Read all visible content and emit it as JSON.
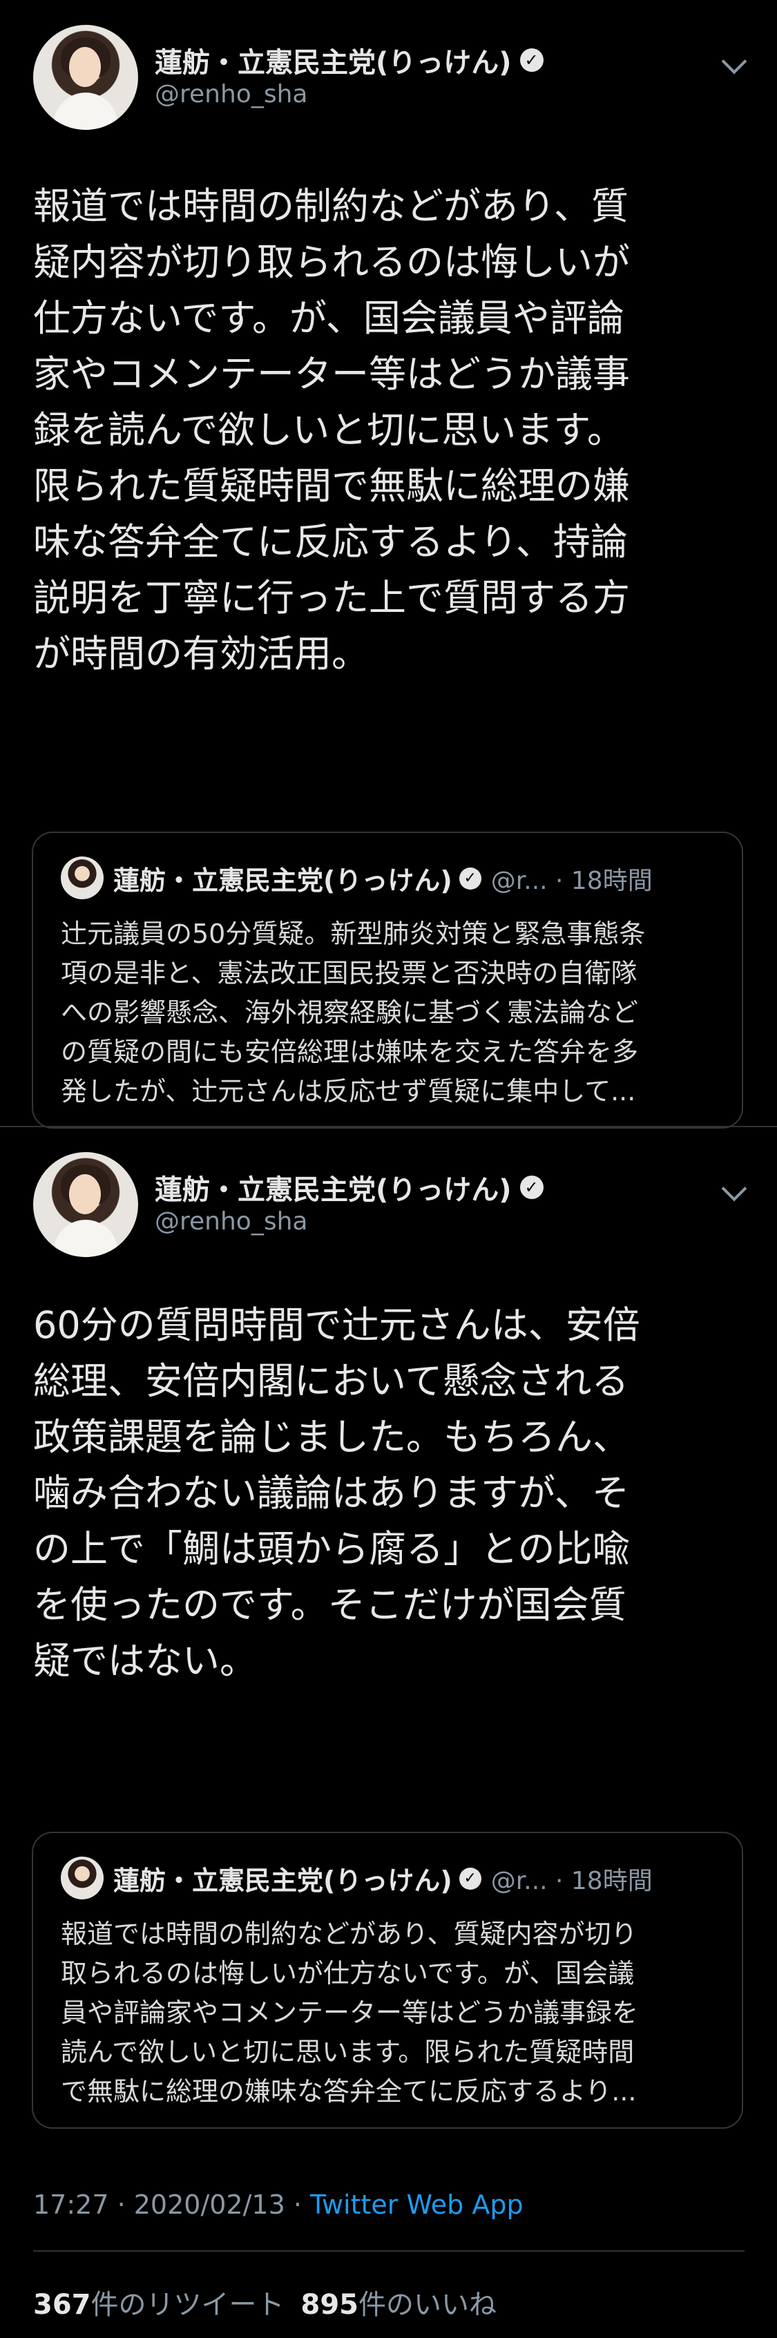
{
  "tweet1": {
    "author_name": "蓮舫・立憲民主党(りっけん)",
    "handle": "@renho_sha",
    "body": "報道では時間の制約などがあり、質\n疑内容が切り取られるのは悔しいが\n仕方ないです。が、国会議員や評論\n家やコメンテーター等はどうか議事\n録を読んで欲しいと切に思います。\n限られた質疑時間で無駄に総理の嫌\n味な答弁全てに反応するより、持論\n説明を丁寧に行った上で質問する方\nが時間の有効活用。",
    "quote": {
      "author_name": "蓮舫・立憲民主党(りっけん)",
      "handle_time": "@r... · 18時間",
      "text": "辻元議員の50分質疑。新型肺炎対策と緊急事態条\n項の是非と、憲法改正国民投票と否決時の自衛隊\nへの影響懸念、海外視察経験に基づく憲法論など\nの質疑の間にも安倍総理は嫌味を交えた答弁を多\n発したが、辻元さんは反応せず質疑に集中して..."
    }
  },
  "tweet2": {
    "author_name": "蓮舫・立憲民主党(りっけん)",
    "handle": "@renho_sha",
    "body": "60分の質問時間で辻元さんは、安倍\n総理、安倍内閣において懸念される\n政策課題を論じました。もちろん、\n噛み合わない議論はありますが、そ\nの上で「鯛は頭から腐る」との比喩\nを使ったのです。そこだけが国会質\n疑ではない。",
    "quote": {
      "author_name": "蓮舫・立憲民主党(りっけん)",
      "handle_time": "@r... · 18時間",
      "text": "報道では時間の制約などがあり、質疑内容が切り\n取られるのは悔しいが仕方ないです。が、国会議\n員や評論家やコメンテーター等はどうか議事録を\n読んで欲しいと切に思います。限られた質疑時間\nで無駄に総理の嫌味な答弁全てに反応するより..."
    },
    "timestamp": "17:27 · 2020/02/13 · ",
    "source_app": "Twitter Web App",
    "retweets_count": "367",
    "retweets_label": "件のリツイート",
    "likes_count": "895",
    "likes_label": "件のいいね"
  },
  "colors": {
    "background": "#000000",
    "link": "#1d9bf0",
    "secondary_text": "#8b98a5"
  }
}
